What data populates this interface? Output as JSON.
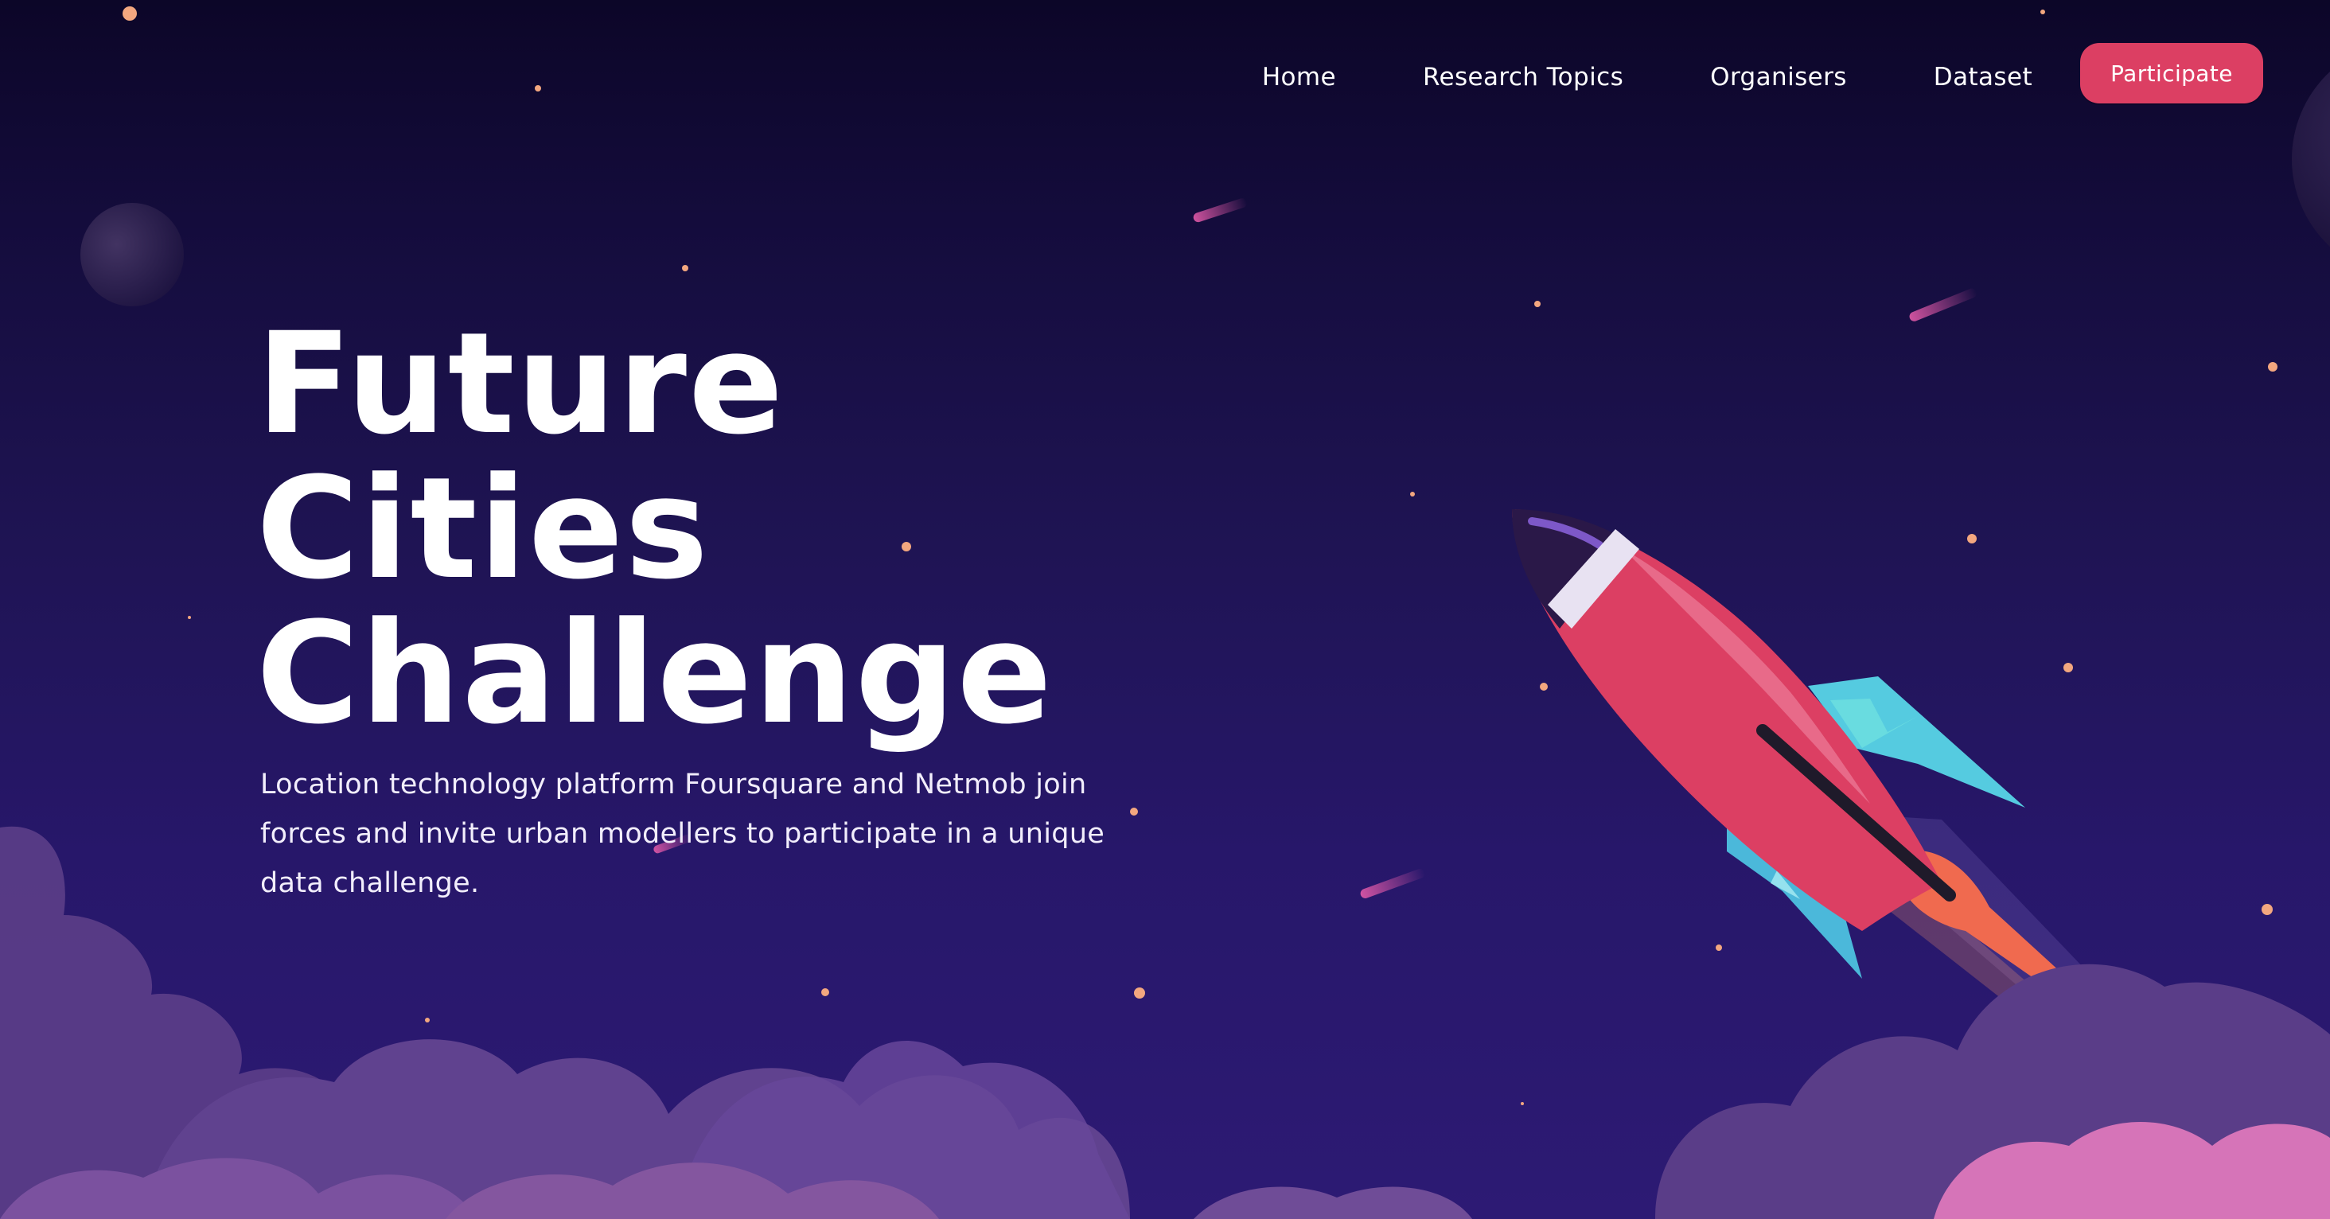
{
  "nav": {
    "items": [
      {
        "label": "Home"
      },
      {
        "label": "Research Topics"
      },
      {
        "label": "Organisers"
      },
      {
        "label": "Dataset"
      }
    ],
    "cta_label": "Participate"
  },
  "hero": {
    "title_lines": [
      "Future",
      "Cities",
      "Challenge"
    ],
    "description": "Location technology platform Foursquare and Netmob join forces and invite urban modellers to participate in a unique data challenge."
  },
  "colors": {
    "background_top": "#0c0628",
    "background_bottom": "#2d1a74",
    "accent": "#dc3f63",
    "rocket_body": "#dc3f63",
    "rocket_fins": "#4fc6d6",
    "cloud": "#5e3f8c",
    "cloud_pink": "#d674b8",
    "star": "#f3a77f"
  },
  "illustration": {
    "icon": "rocket-icon"
  }
}
